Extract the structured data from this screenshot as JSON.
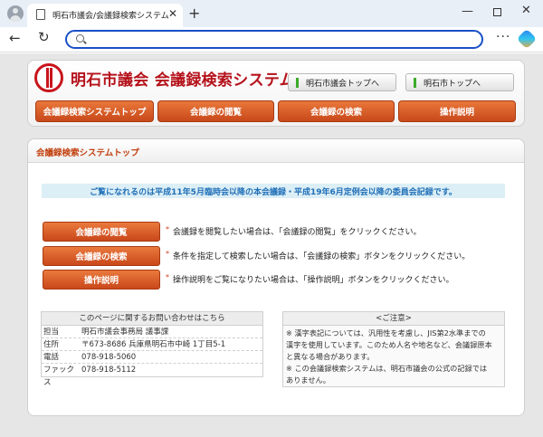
{
  "browser": {
    "tab_title": "明石市議会/会議録検索システム",
    "tab_close": "✕",
    "new_tab": "+",
    "win_min": "—",
    "win_close": "✕",
    "back": "←",
    "reload": "↻",
    "more": "···"
  },
  "header": {
    "site_title": "明石市議会 会議録検索システム",
    "link_council_top": "明石市議会トップへ",
    "link_city_top": "明石市トップへ"
  },
  "nav": {
    "items": [
      {
        "label": "会議録検索システムトップ"
      },
      {
        "label": "会議録の閲覧"
      },
      {
        "label": "会議録の検索"
      },
      {
        "label": "操作説明"
      }
    ]
  },
  "main": {
    "panel_title": "会議録検索システムトップ",
    "notice": "ご覧になれるのは平成11年5月臨時会以降の本会議録・平成19年6月定例会以降の委員会記録です。",
    "actions": [
      {
        "button": "会議録の閲覧",
        "mark": "*",
        "description": "会議録を閲覧したい場合は、「会議録の閲覧」をクリックください。"
      },
      {
        "button": "会議録の検索",
        "mark": "*",
        "description": "条件を指定して検索したい場合は、「会議録の検索」ボタンをクリックください。"
      },
      {
        "button": "操作説明",
        "mark": "*",
        "description": "操作説明をご覧になりたい場合は、「操作説明」ボタンをクリックください。"
      }
    ]
  },
  "contact": {
    "heading": "このページに関するお問い合わせはこちら",
    "rows": [
      {
        "label": "担当",
        "value": "明石市議会事務局 議事課"
      },
      {
        "label": "住所",
        "value": "〒673-8686 兵庫県明石市中崎 1丁目5-1"
      },
      {
        "label": "電話",
        "value": "078-918-5060"
      },
      {
        "label": "ファックス",
        "value": "078-918-5112"
      }
    ]
  },
  "caution": {
    "heading": "<ご注意>",
    "lines": [
      "※ 漢字表記については、汎用性を考慮し、JIS第2水準までの",
      "漢字を使用しています。このため人名や地名など、会議録原本",
      "と異なる場合があります。",
      "※ この会議録検索システムは、明石市議会の公式の記録では",
      "ありません。"
    ]
  },
  "colors": {
    "accent_orange": "#c8491a",
    "title_red": "#b5121b",
    "notice_blue": "#1f6fb8",
    "address_border": "#1a4fc7"
  }
}
